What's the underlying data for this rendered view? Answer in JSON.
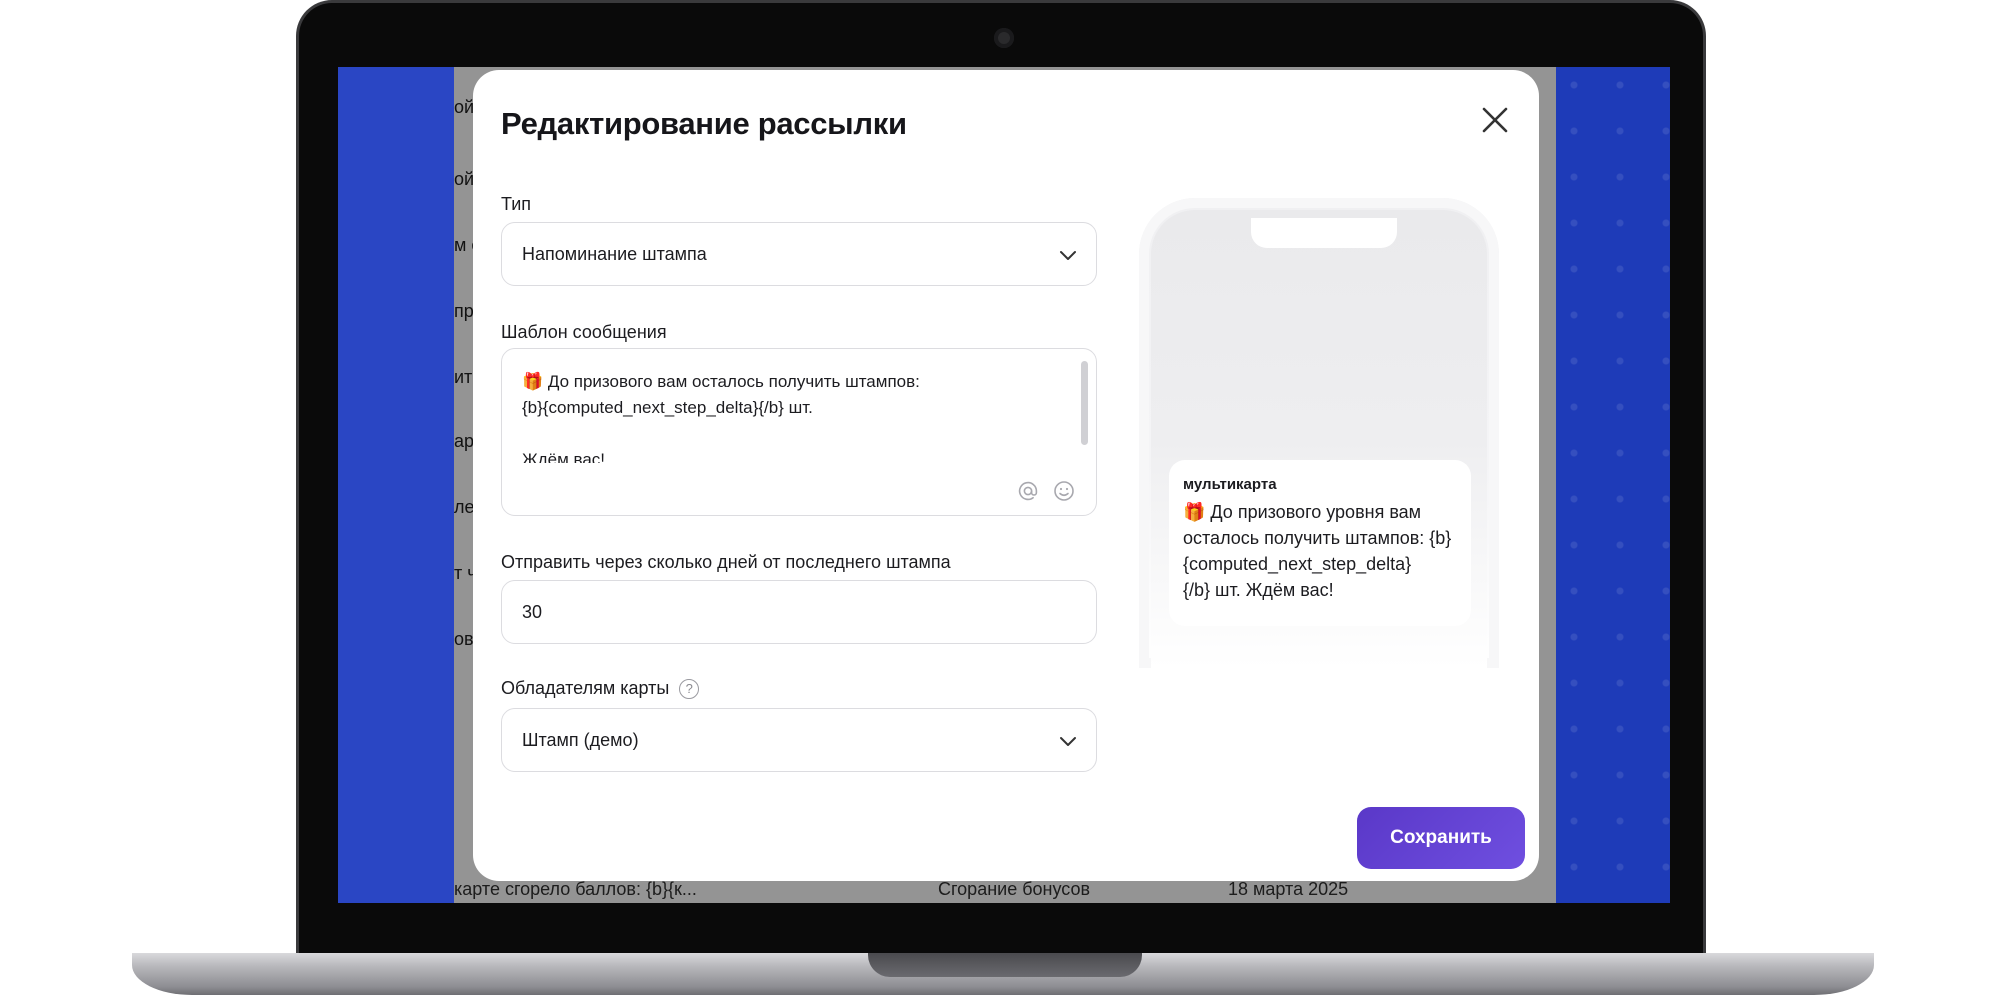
{
  "modal": {
    "title": "Редактирование рассылки",
    "type_label": "Тип",
    "type_value": "Напоминание штампа",
    "template_label": "Шаблон сообщения",
    "template_lines": [
      "🎁 До призового вам осталось получить штампов:",
      " {b}{computed_next_step_delta}{/b} шт.",
      "",
      "Ждём вас!"
    ],
    "days_label": "Отправить через сколько дней от последнего штампа",
    "days_value": "30",
    "holders_label": "Обладателям карты",
    "holders_value": "Штамп (демо)",
    "save_label": "Сохранить"
  },
  "preview": {
    "app_name": "мультикарта",
    "message_lines": [
      "🎁 До призового уровня вам",
      "осталось получить штампов: {b}",
      "{computed_next_step_delta}",
      "{/b} шт. Ждём вас!"
    ]
  },
  "background": {
    "list_fragments": [
      "ой г",
      "ой г",
      "м о",
      "пра",
      "ить",
      "арт",
      "ле",
      "т ч",
      "ова"
    ],
    "row": {
      "text": "карте сгорело баллов: {b}{к...",
      "type": "Сгорание бонусов",
      "date": "18 марта 2025"
    }
  },
  "icons": {
    "close": "close-icon",
    "chevron": "chevron-down-icon",
    "mention": "at-icon",
    "emoji": "emoji-icon",
    "help": "help-icon"
  },
  "colors": {
    "accent": "#5a38c8",
    "brand_blue": "#2a46c4"
  }
}
